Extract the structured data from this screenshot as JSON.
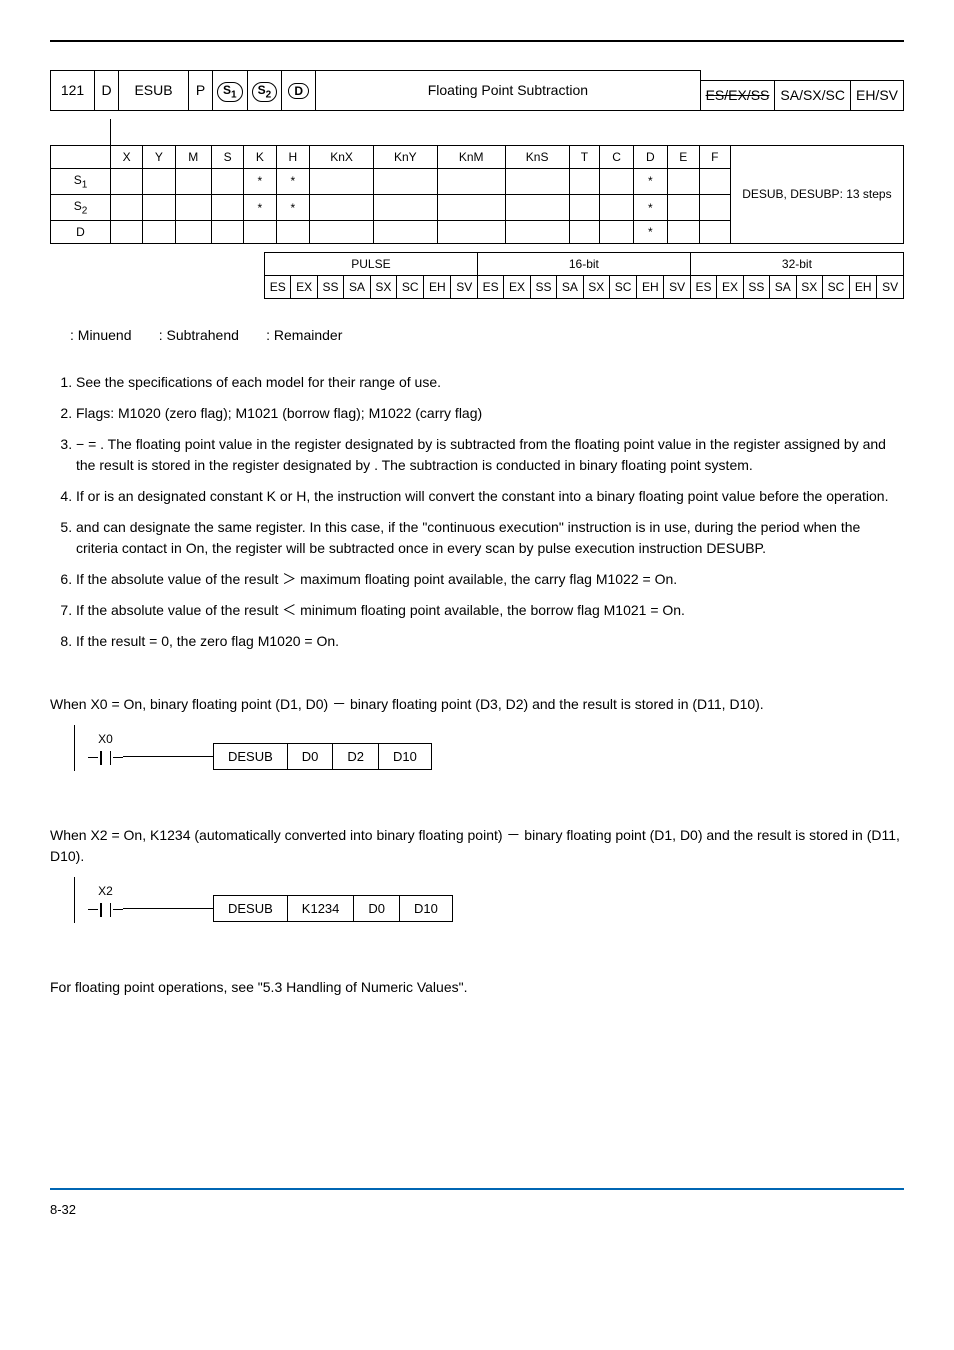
{
  "header": {
    "api": "121",
    "d": "D",
    "mnemonic": "ESUB",
    "p": "P",
    "op1": "S₁",
    "op2": "S₂",
    "op3": "D",
    "title": "Floating Point Subtraction",
    "models": {
      "a": "ES/EX/SS",
      "b": "SA/SX/SC",
      "c": "EH/SV"
    }
  },
  "grid": {
    "cols": [
      "X",
      "Y",
      "M",
      "S",
      "K",
      "H",
      "KnX",
      "KnY",
      "KnM",
      "KnS",
      "T",
      "C",
      "D",
      "E",
      "F"
    ],
    "rows": [
      "S1",
      "S2",
      "D"
    ],
    "notes": "DESUB, DESUBP: 13 steps",
    "s1": {
      "K": "*",
      "H": "*",
      "D": "*"
    },
    "s2": {
      "K": "*",
      "H": "*",
      "D": "*"
    },
    "d": {
      "D": "*"
    }
  },
  "footer": {
    "groups": [
      "PULSE",
      "16-bit",
      "32-bit"
    ],
    "cells": [
      "ES",
      "EX",
      "SS",
      "SA",
      "SX",
      "SC",
      "EH",
      "SV",
      "ES",
      "EX",
      "SS",
      "SA",
      "SX",
      "SC",
      "EH",
      "SV",
      "ES",
      "EX",
      "SS",
      "SA",
      "SX",
      "SC",
      "EH",
      "SV"
    ]
  },
  "operands_line": {
    "s1": ": Minuend",
    "s2": ": Subtrahend",
    "d": ": Remainder"
  },
  "notes": {
    "n1": "See the specifications of each model for their range of use.",
    "n2": "Flags: M1020 (zero flag); M1021 (borrow flag); M1022 (carry flag)",
    "n3a": " − ",
    "n3b": " = ",
    "n3c": ". The floating point value in the register designated by ",
    "n3d": " is subtracted from the floating point value in the register assigned by ",
    "n3e": " and the result is stored in the register designated by ",
    "n3f": ". The subtraction is conducted in binary floating point system.",
    "n4a": "If ",
    "n4b": " or ",
    "n4c": " is an designated constant K or H, the instruction will convert the constant into a binary floating point value before the operation.",
    "n5a": " and ",
    "n5b": " can designate the same register. In this case, if the \"continuous execution\" instruction is in use, during the period when the criteria contact in On, the register will be subtracted once in every scan by pulse execution instruction DESUBP.",
    "n6": "If the absolute value of the result ＞ maximum floating point available, the carry flag M1022 = On.",
    "n7": "If the absolute value of the result ＜ minimum floating point available, the borrow flag M1021 = On.",
    "n8": "If the result = 0, the zero flag M1020 = On."
  },
  "ex1": {
    "text": "When X0 = On, binary floating point (D1, D0) － binary floating point (D3, D2) and the result is stored in (D11, D10).",
    "contact": "X0",
    "cells": [
      "DESUB",
      "D0",
      "D2",
      "D10"
    ]
  },
  "ex2": {
    "text1": "When X2 = On, K1234 (automatically converted into binary floating point) － binary floating point (D1, D0) and the result is stored in (D11, D10).",
    "contact": "X2",
    "cells": [
      "DESUB",
      "K1234",
      "D0",
      "D10"
    ]
  },
  "remark": "For floating point operations, see \"5.3 Handling of Numeric Values\".",
  "page": "8-32"
}
